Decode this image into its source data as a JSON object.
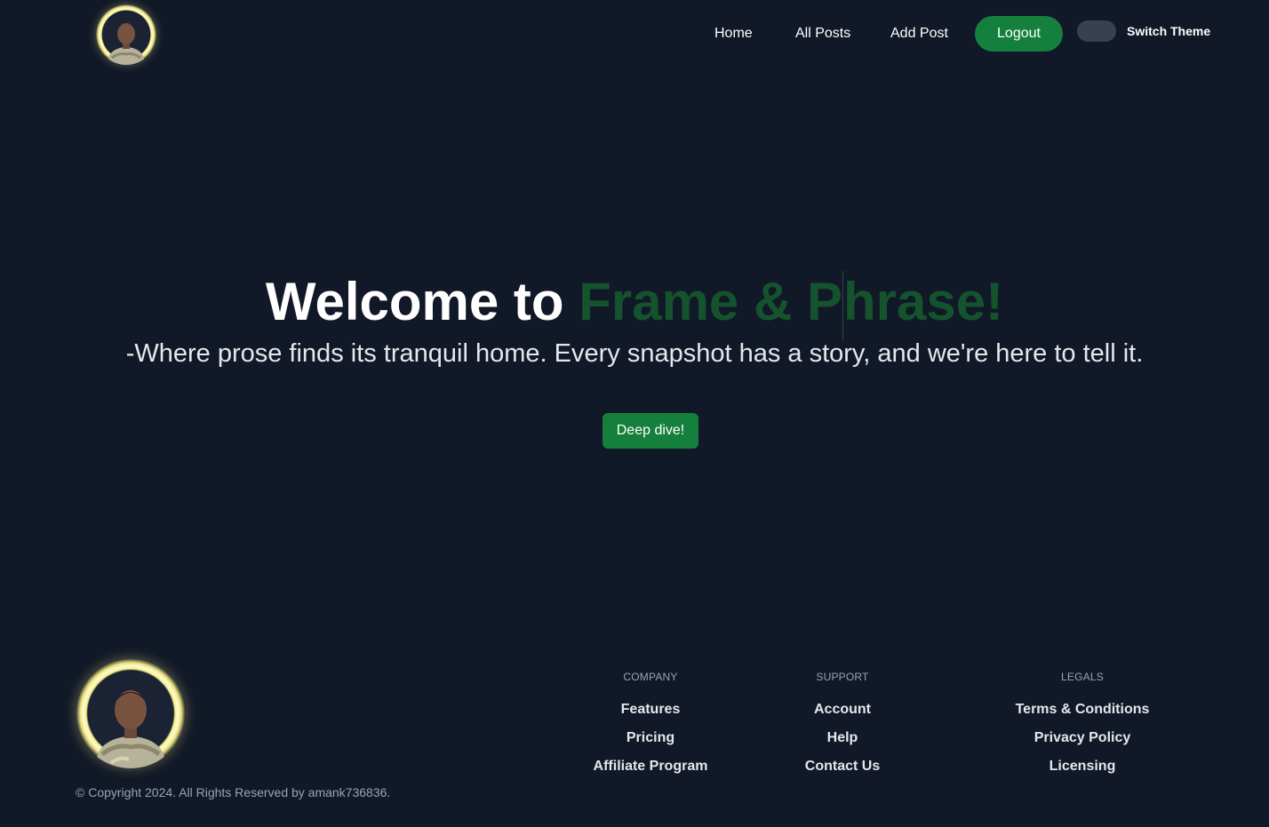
{
  "header": {
    "nav": [
      {
        "label": "Home"
      },
      {
        "label": "All Posts"
      },
      {
        "label": "Add Post"
      }
    ],
    "logout_label": "Logout",
    "theme_label": "Switch Theme"
  },
  "hero": {
    "title_prefix": "Welcome to ",
    "title_accent_a": "Frame & P",
    "title_accent_b": "hrase!",
    "subtitle": "-Where prose finds its tranquil home. Every snapshot has a story, and we're here to tell it.",
    "cta_label": "Deep dive!"
  },
  "footer": {
    "columns": [
      {
        "heading": "Company",
        "links": [
          "Features",
          "Pricing",
          "Affiliate Program"
        ]
      },
      {
        "heading": "Support",
        "links": [
          "Account",
          "Help",
          "Contact Us"
        ]
      },
      {
        "heading": "Legals",
        "links": [
          "Terms & Conditions",
          "Privacy Policy",
          "Licensing"
        ]
      }
    ],
    "copyright": "© Copyright 2024. All Rights Reserved by amank736836."
  },
  "colors": {
    "background": "#111827",
    "accent_green": "#15803d",
    "title_accent": "#14532d",
    "muted_text": "#9ca3af"
  },
  "icons": [
    "avatar-logo",
    "theme-toggle"
  ]
}
